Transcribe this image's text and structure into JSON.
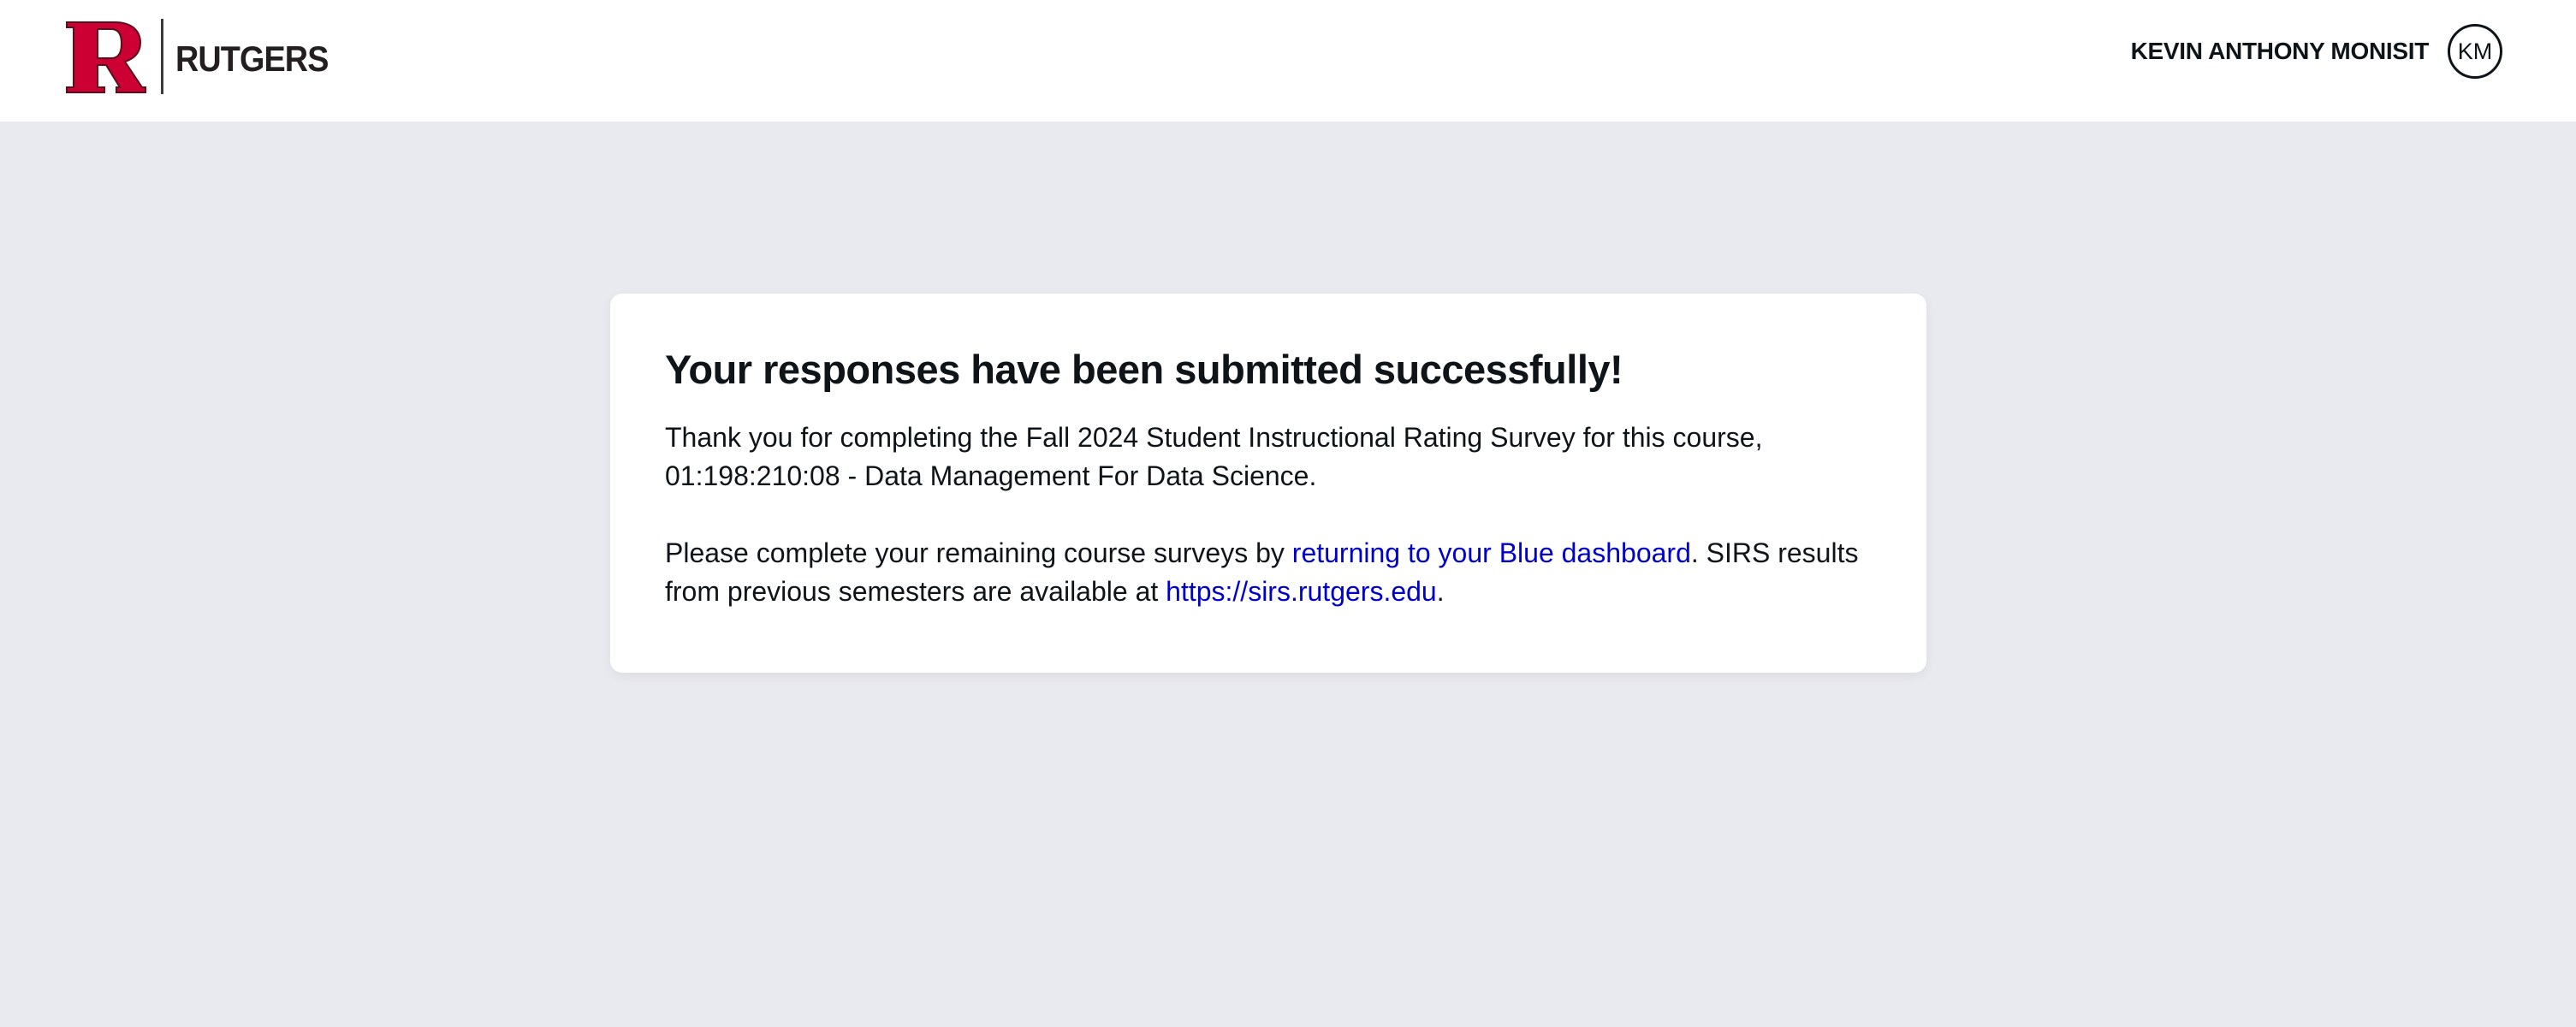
{
  "header": {
    "logo_text": "RUTGERS",
    "logo_letter": "R",
    "user_name": "KEVIN ANTHONY MONISIT",
    "user_initials": "KM"
  },
  "message": {
    "title": "Your responses have been submitted successfully!",
    "para1_line1": "Thank you for completing the Fall 2024 Student Instructional Rating Survey for this course,",
    "para1_line2": "01:198:210:08 - Data Management For Data Science.",
    "para2_text1": "Please complete your remaining course surveys by ",
    "para2_link1": "returning to your Blue dashboard",
    "para2_text2": ". SIRS results",
    "para2_text3": "from previous semesters are available at ",
    "para2_link2": "https://sirs.rutgers.edu",
    "para2_text4": "."
  },
  "colors": {
    "page_background": "#e9eaef",
    "brand_red": "#cc0033",
    "link_blue": "#0000cc",
    "text": "#0f1419"
  },
  "icons": {
    "logo": "rutgers-r-logo-icon"
  }
}
